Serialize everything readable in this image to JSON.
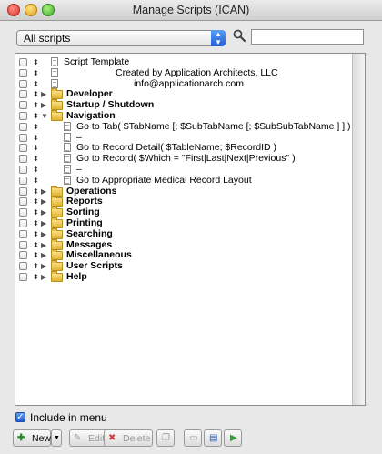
{
  "window": {
    "title": "Manage Scripts (ICAN)"
  },
  "filter": {
    "selected": "All scripts",
    "search_value": "",
    "search_placeholder": ""
  },
  "rows": [
    {
      "label": "Script Template",
      "type": "script",
      "level": 0
    },
    {
      "label": "Created by Application Architects, LLC",
      "type": "script",
      "level": 0,
      "indent_center": true
    },
    {
      "label": "info@applicationarch.com",
      "type": "script",
      "level": 0,
      "indent_center": true
    },
    {
      "label": "Developer",
      "type": "folder",
      "expanded": false
    },
    {
      "label": "Startup / Shutdown",
      "type": "folder",
      "expanded": false
    },
    {
      "label": "Navigation",
      "type": "folder",
      "expanded": true
    },
    {
      "label": "Go to Tab( $TabName [; $SubTabName [; $SubSubTabName ] ] )",
      "type": "script",
      "level": 1
    },
    {
      "label": "–",
      "type": "separator",
      "level": 1
    },
    {
      "label": "Go to Record Detail( $TableName; $RecordID )",
      "type": "script",
      "level": 1
    },
    {
      "label": "Go to Record( $Which = \"First|Last|Next|Previous\" )",
      "type": "script",
      "level": 1
    },
    {
      "label": "–",
      "type": "separator",
      "level": 1
    },
    {
      "label": "Go to Appropriate Medical Record Layout",
      "type": "script",
      "level": 1
    },
    {
      "label": "Operations",
      "type": "folder",
      "expanded": false
    },
    {
      "label": "Reports",
      "type": "folder",
      "expanded": false
    },
    {
      "label": "Sorting",
      "type": "folder",
      "expanded": false
    },
    {
      "label": "Printing",
      "type": "folder",
      "expanded": false
    },
    {
      "label": "Searching",
      "type": "folder",
      "expanded": false
    },
    {
      "label": "Messages",
      "type": "folder",
      "expanded": false
    },
    {
      "label": "Miscellaneous",
      "type": "folder",
      "expanded": false
    },
    {
      "label": "User Scripts",
      "type": "folder",
      "expanded": false
    },
    {
      "label": "Help",
      "type": "folder",
      "expanded": false
    }
  ],
  "include_in_menu": {
    "label": "Include in menu",
    "checked": true
  },
  "toolbar": {
    "new_label": "New",
    "edit_label": "Edit",
    "delete_label": "Delete"
  }
}
